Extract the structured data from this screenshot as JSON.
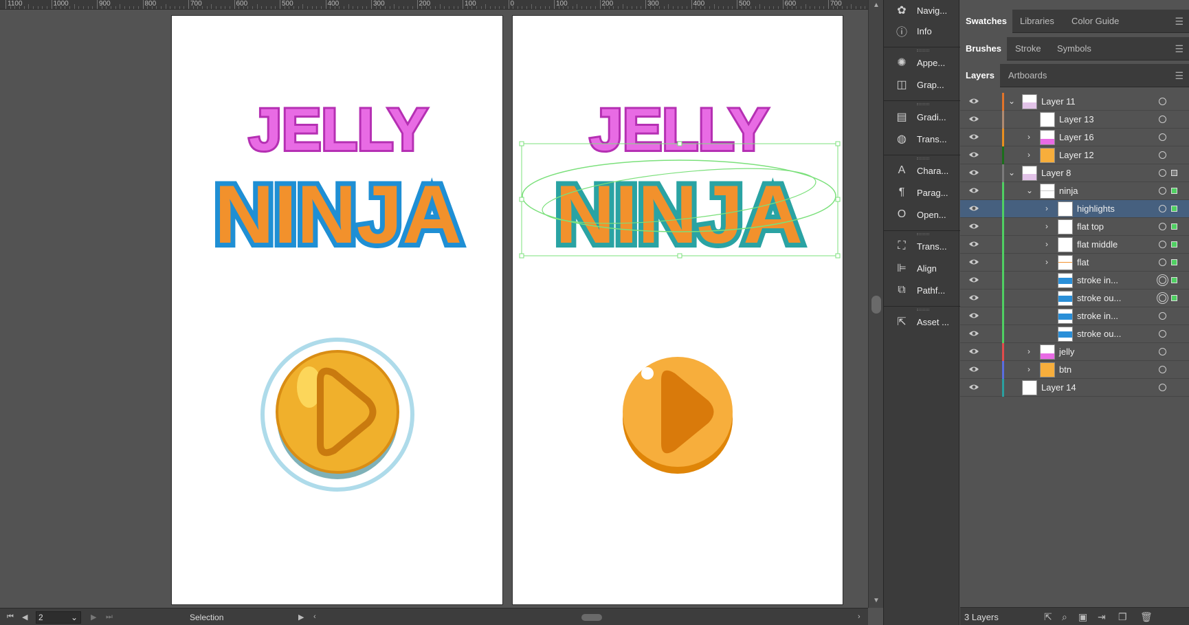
{
  "ruler": {
    "labels": [
      "1100",
      "1000",
      "900",
      "800",
      "700",
      "600",
      "500",
      "400",
      "300",
      "200",
      "100",
      "0",
      "100",
      "200",
      "300",
      "400",
      "500",
      "600",
      "700"
    ]
  },
  "dock": {
    "items": [
      {
        "label": "Navig...",
        "icon": "navigator-icon"
      },
      {
        "label": "Info",
        "icon": "info-icon"
      },
      {
        "label": "Appe...",
        "icon": "appearance-icon"
      },
      {
        "label": "Grap...",
        "icon": "graphic-styles-icon"
      },
      {
        "label": "Gradi...",
        "icon": "gradient-icon"
      },
      {
        "label": "Trans...",
        "icon": "transparency-icon"
      },
      {
        "label": "Chara...",
        "icon": "character-icon"
      },
      {
        "label": "Parag...",
        "icon": "paragraph-icon"
      },
      {
        "label": "Open...",
        "icon": "opentype-icon"
      },
      {
        "label": "Trans...",
        "icon": "transform-icon"
      },
      {
        "label": "Align",
        "icon": "align-icon"
      },
      {
        "label": "Pathf...",
        "icon": "pathfinder-icon"
      },
      {
        "label": "Asset ...",
        "icon": "asset-export-icon"
      }
    ]
  },
  "panels": {
    "row1": {
      "tabs": [
        "Swatches",
        "Libraries",
        "Color Guide"
      ]
    },
    "row2": {
      "tabs": [
        "Brushes",
        "Stroke",
        "Symbols"
      ]
    },
    "row3": {
      "tabs": [
        "Layers",
        "Artboards"
      ]
    }
  },
  "layers": [
    {
      "name": "Layer 11",
      "indent": 0,
      "expand": "open",
      "color": "#e2742a",
      "thumb": "art",
      "target": "single",
      "selsq": false
    },
    {
      "name": "Layer 13",
      "indent": 1,
      "expand": "none",
      "color": "#b08a70",
      "thumb": "blank",
      "target": "single",
      "selsq": false
    },
    {
      "name": "Layer 16",
      "indent": 1,
      "expand": "closed",
      "color": "#e98f1f",
      "thumb": "jelly",
      "target": "single",
      "selsq": false
    },
    {
      "name": "Layer 12",
      "indent": 1,
      "expand": "closed",
      "color": "#1b6e1b",
      "thumb": "btn",
      "target": "single",
      "selsq": false
    },
    {
      "name": "Layer 8",
      "indent": 0,
      "expand": "open",
      "color": "#7a7a7a",
      "thumb": "art",
      "target": "single",
      "selsq": true
    },
    {
      "name": "ninja",
      "indent": 1,
      "expand": "open",
      "color": "#4fd062",
      "thumb": "line",
      "target": "single",
      "selsq": true
    },
    {
      "name": "highlights",
      "indent": 2,
      "expand": "closed",
      "color": "#4fd062",
      "thumb": "blank",
      "target": "single",
      "selsq": true,
      "selected": true
    },
    {
      "name": "flat top",
      "indent": 2,
      "expand": "closed",
      "color": "#4fd062",
      "thumb": "blank",
      "target": "single",
      "selsq": true
    },
    {
      "name": "flat middle",
      "indent": 2,
      "expand": "closed",
      "color": "#4fd062",
      "thumb": "blank",
      "target": "single",
      "selsq": true
    },
    {
      "name": "flat",
      "indent": 2,
      "expand": "closed",
      "color": "#4fd062",
      "thumb": "dash",
      "target": "single",
      "selsq": true
    },
    {
      "name": "stroke in...",
      "indent": 2,
      "expand": "none",
      "color": "#4fd062",
      "thumb": "blue",
      "target": "double",
      "selsq": true
    },
    {
      "name": "stroke ou...",
      "indent": 2,
      "expand": "none",
      "color": "#4fd062",
      "thumb": "blue",
      "target": "double",
      "selsq": true
    },
    {
      "name": "stroke in...",
      "indent": 2,
      "expand": "none",
      "color": "#4fd062",
      "thumb": "blue",
      "target": "single",
      "selsq": false
    },
    {
      "name": "stroke ou...",
      "indent": 2,
      "expand": "none",
      "color": "#4fd062",
      "thumb": "blue",
      "target": "single",
      "selsq": false
    },
    {
      "name": "jelly",
      "indent": 1,
      "expand": "closed",
      "color": "#e24b4b",
      "thumb": "jelly",
      "target": "single",
      "selsq": false
    },
    {
      "name": "btn",
      "indent": 1,
      "expand": "closed",
      "color": "#5a6de0",
      "thumb": "btn",
      "target": "single",
      "selsq": false
    },
    {
      "name": "Layer 14",
      "indent": 0,
      "expand": "none",
      "color": "#2aa0a0",
      "thumb": "blank",
      "target": "single",
      "selsq": false
    }
  ],
  "footer": {
    "count": "3 Layers"
  },
  "status": {
    "zoom": "2",
    "tool": "Selection"
  },
  "artwork": {
    "word1": "JELLY",
    "word2": "NINJA"
  }
}
